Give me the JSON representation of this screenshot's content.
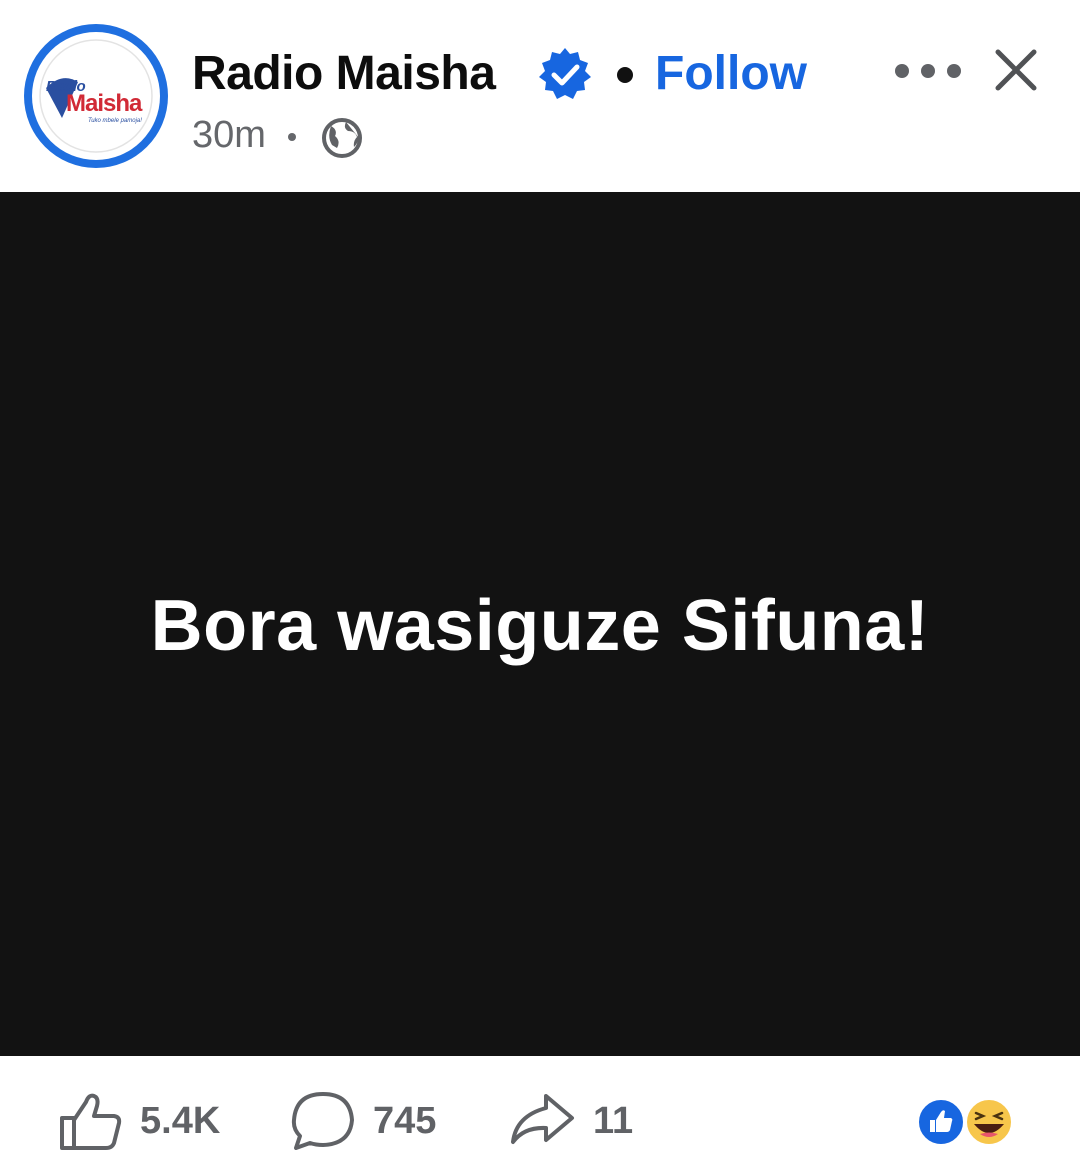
{
  "header": {
    "page_name": "Radio Maisha",
    "follow_label": "Follow",
    "time_ago": "30m",
    "avatar_logo": {
      "line1": "Radio",
      "line2": "Maisha",
      "tagline": "Tuko mbele pamoja!"
    },
    "icons": {
      "verified": "verified-badge-icon",
      "audience": "globe-icon",
      "more": "more-options-icon",
      "close": "close-icon"
    }
  },
  "post": {
    "text": "Bora wasiguze Sifuna!",
    "background_color": "#121212",
    "text_color": "#ffffff"
  },
  "footer": {
    "likes": "5.4K",
    "comments": "745",
    "shares": "11",
    "reaction_icons": [
      "like-reaction-icon",
      "haha-reaction-icon"
    ]
  },
  "colors": {
    "accent": "#1766e0",
    "muted_text": "#65676b"
  }
}
